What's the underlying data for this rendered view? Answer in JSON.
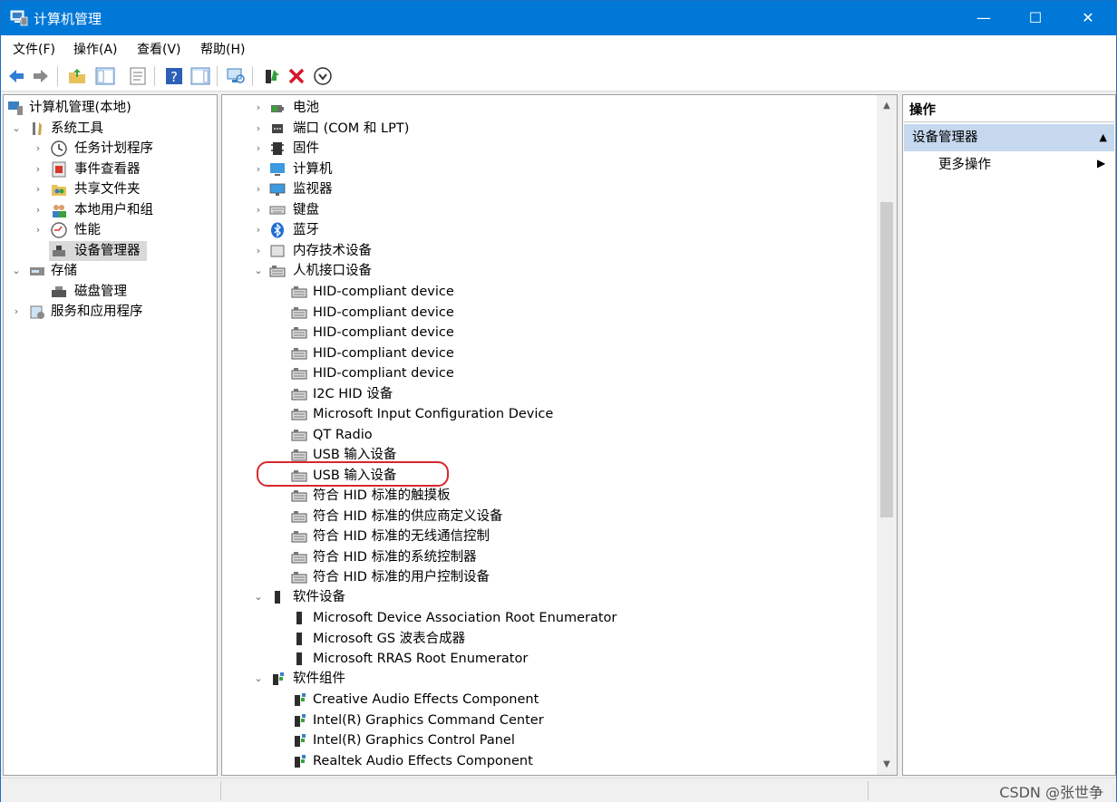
{
  "window": {
    "title": "计算机管理",
    "controls": {
      "minimize": "—",
      "maximize": "☐",
      "close": "✕"
    }
  },
  "menu": [
    "文件(F)",
    "操作(A)",
    "查看(V)",
    "帮助(H)"
  ],
  "toolbar": {
    "icons": [
      "back-arrow-icon",
      "forward-arrow-icon",
      "up-folder-icon",
      "show-hide-tree-icon",
      "properties-icon",
      "help-icon",
      "show-action-pane-icon",
      "scan-hardware-icon",
      "update-driver-icon",
      "uninstall-device-icon",
      "disable-device-icon"
    ]
  },
  "tree": {
    "root": "计算机管理(本地)",
    "system_tools": "系统工具",
    "task_scheduler": "任务计划程序",
    "event_viewer": "事件查看器",
    "shared_folders": "共享文件夹",
    "local_users": "本地用户和组",
    "performance": "性能",
    "device_manager": "设备管理器",
    "storage": "存储",
    "disk_management": "磁盘管理",
    "services": "服务和应用程序"
  },
  "devices": {
    "battery": "电池",
    "ports": "端口 (COM 和 LPT)",
    "firmware": "固件",
    "computer": "计算机",
    "monitors": "监视器",
    "keyboards": "键盘",
    "bluetooth": "蓝牙",
    "memory_tech": "内存技术设备",
    "hid": "人机接口设备",
    "hid_items": [
      "HID-compliant device",
      "HID-compliant device",
      "HID-compliant device",
      "HID-compliant device",
      "HID-compliant device",
      "I2C HID 设备",
      "Microsoft Input Configuration Device",
      "QT Radio",
      "USB 输入设备",
      "USB 输入设备",
      "符合 HID 标准的触摸板",
      "符合 HID 标准的供应商定义设备",
      "符合 HID 标准的无线通信控制",
      "符合 HID 标准的系统控制器",
      "符合 HID 标准的用户控制设备"
    ],
    "software_devices": "软件设备",
    "software_device_items": [
      "Microsoft Device Association Root Enumerator",
      "Microsoft GS 波表合成器",
      "Microsoft RRAS Root Enumerator"
    ],
    "software_components": "软件组件",
    "software_component_items": [
      "Creative Audio Effects Component",
      "Intel(R) Graphics Command Center",
      "Intel(R) Graphics Control Panel",
      "Realtek Audio Effects Component"
    ]
  },
  "actions": {
    "header": "操作",
    "section": "设备管理器",
    "more": "更多操作"
  },
  "watermark": "CSDN @张世争",
  "colors": {
    "titlebar": "#0078d7",
    "selection": "#cce8ff",
    "highlight_ring": "#d9262b"
  }
}
